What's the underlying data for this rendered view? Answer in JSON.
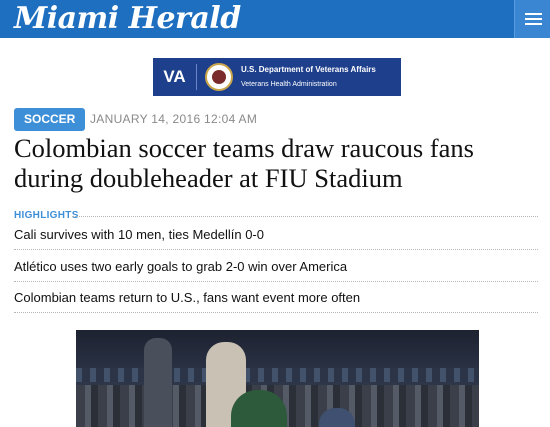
{
  "header": {
    "masthead": "Miami Herald",
    "menu_icon": "hamburger-icon",
    "colors": {
      "bar": "#1e6fc0",
      "menu": "#3a86d2"
    }
  },
  "ad": {
    "va_label": "VA",
    "seal_icon": "va-seal-icon",
    "line1": "U.S. Department of Veterans Affairs",
    "line2": "Veterans Health Administration",
    "background": "#1e3f8c"
  },
  "article": {
    "section_tag": "SOCCER",
    "dateline": "JANUARY 14, 2016 12:04 AM",
    "headline": "Colombian soccer teams draw raucous fans during doubleheader at FIU Stadium",
    "accent": "#3d8fd8"
  },
  "highlights": {
    "label": "HIGHLIGHTS",
    "items": [
      "Cali survives with 10 men, ties Medellín 0-0",
      "Atlético uses two early goals to grab 2-0 win over America",
      "Colombian teams return to U.S., fans want event more often"
    ]
  }
}
